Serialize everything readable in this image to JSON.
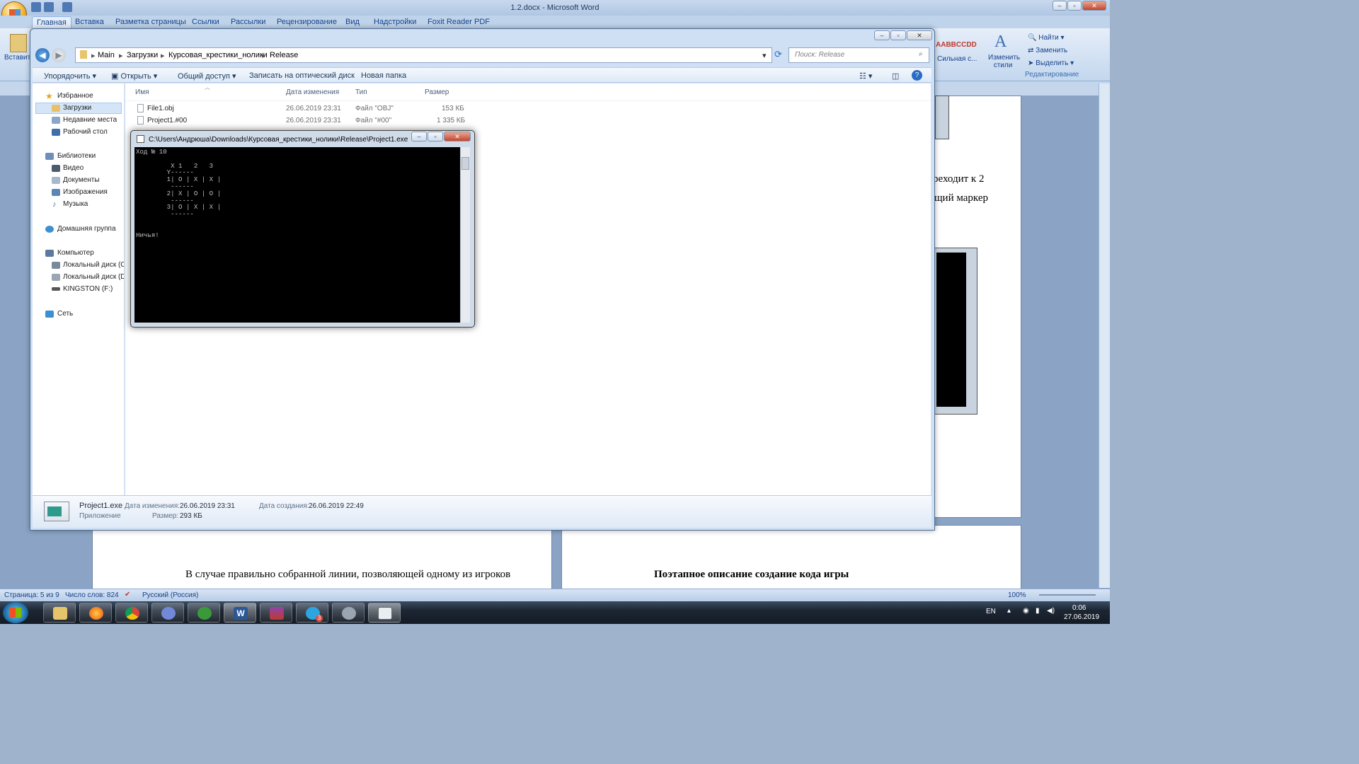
{
  "word": {
    "title": "1.2.docx - Microsoft Word",
    "tabs": [
      "Главная",
      "Вставка",
      "Разметка страницы",
      "Ссылки",
      "Рассылки",
      "Рецензирование",
      "Вид",
      "Надстройки",
      "Foxit Reader PDF"
    ],
    "paste_label": "Вставить",
    "style_preview": "AABBCCDD",
    "style_name": "Сильная с...",
    "change_styles": "Изменить стили",
    "find": "Найти",
    "replace": "Заменить",
    "select": "Выделить",
    "editing_group": "Редактирование",
    "doc_text": {
      "right_1": "реходит к 2",
      "right_2": "щий маркер",
      "left_bottom": "В случае правильно собранной линии, позволяющей одному из игроков",
      "right_bottom": "Поэтапное описание создание кода игры"
    },
    "status": {
      "page": "Страница: 5 из 9",
      "words": "Число слов: 824",
      "language": "Русский (Россия)",
      "zoom": "100%"
    }
  },
  "explorer": {
    "breadcrumb": [
      "Main",
      "Загрузки",
      "Курсовая_крестики_нолики",
      "Release"
    ],
    "search_placeholder": "Поиск: Release",
    "toolbar": {
      "organize": "Упорядочить",
      "open": "Открыть",
      "share": "Общий доступ",
      "burn": "Записать на оптический диск",
      "new_folder": "Новая папка"
    },
    "nav": {
      "favorites": "Избранное",
      "downloads": "Загрузки",
      "recent": "Недавние места",
      "desktop": "Рабочий стол",
      "libraries": "Библиотеки",
      "video": "Видео",
      "documents": "Документы",
      "images": "Изображения",
      "music": "Музыка",
      "homegroup": "Домашняя группа",
      "computer": "Компьютер",
      "disk_c": "Локальный диск (C",
      "disk_d": "Локальный диск (D",
      "kingston": "KINGSTON (F:)",
      "network": "Сеть"
    },
    "columns": {
      "name": "Имя",
      "date": "Дата изменения",
      "type": "Тип",
      "size": "Размер"
    },
    "files": [
      {
        "name": "File1.obj",
        "date": "26.06.2019 23:31",
        "type": "Файл \"OBJ\"",
        "size": "153 КБ"
      },
      {
        "name": "Project1.#00",
        "date": "26.06.2019 23:31",
        "type": "Файл \"#00\"",
        "size": "1 335 КБ"
      }
    ],
    "details": {
      "filename": "Project1.exe",
      "kind": "Приложение",
      "modified_label": "Дата изменения:",
      "modified": "26.06.2019 23:31",
      "created_label": "Дата создания:",
      "created": "26.06.2019 22:49",
      "size_label": "Размер:",
      "size": "293 КБ"
    }
  },
  "console": {
    "title": "C:\\Users\\Андрюша\\Downloads\\Курсовая_крестики_нолики\\Release\\Project1.exe",
    "output": "Ход № 10\n\n         X 1   2   3\n        Y------\n        1| O | X | X |\n         ------\n        2| X | O | O |\n         ------\n        3| O | X | X |\n         ------\n\n\nНичья!"
  },
  "taskbar": {
    "lang": "EN",
    "time": "0:06",
    "date": "27.06.2019",
    "telegram_badge": "3"
  }
}
